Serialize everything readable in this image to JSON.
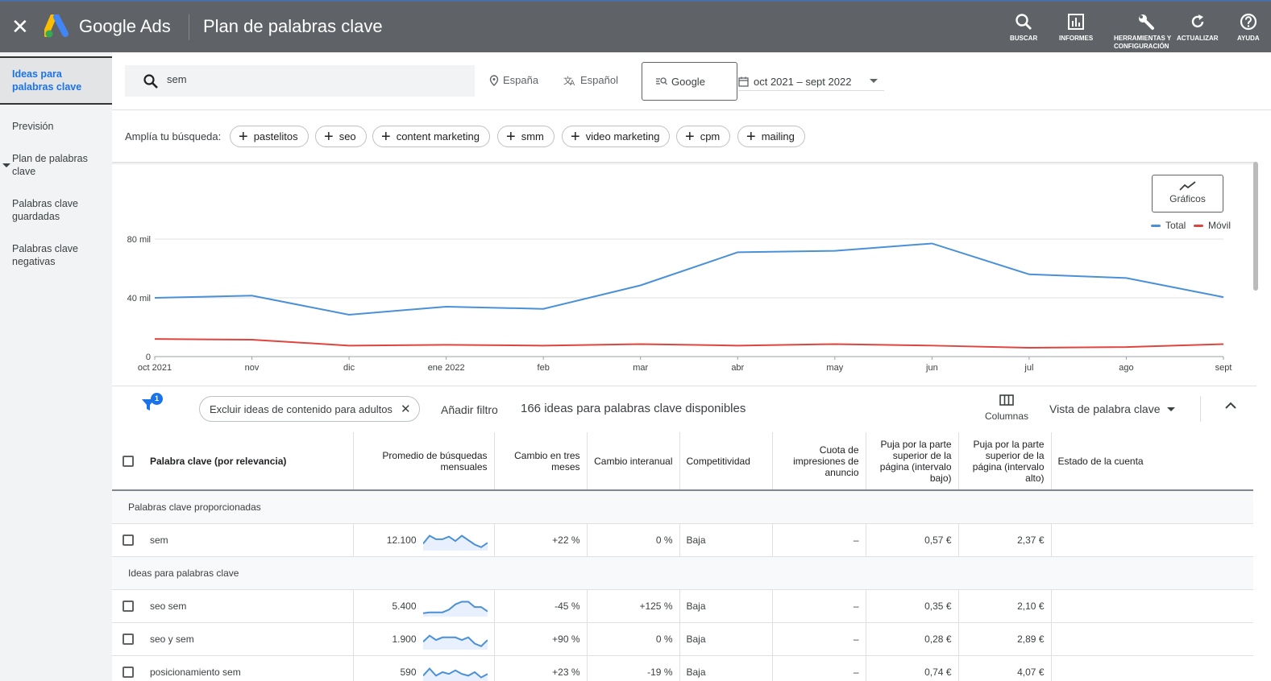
{
  "topbar": {
    "brand": "Google Ads",
    "page_title": "Plan de palabras clave",
    "tools": [
      {
        "label": "BUSCAR",
        "icon": "search-icon"
      },
      {
        "label": "INFORMES",
        "icon": "reports-icon"
      },
      {
        "label": "HERRAMIENTAS Y CONFIGURACIÓN",
        "icon": "wrench-icon"
      },
      {
        "label": "ACTUALIZAR",
        "icon": "refresh-icon"
      },
      {
        "label": "AYUDA",
        "icon": "help-icon"
      }
    ]
  },
  "sidebar": {
    "items": [
      {
        "label": "Ideas para palabras clave",
        "active": true
      },
      {
        "label": "Previsión"
      },
      {
        "label": "Plan de palabras clave"
      },
      {
        "label": "Palabras clave guardadas"
      },
      {
        "label": "Palabras clave negativas"
      }
    ]
  },
  "search": {
    "value": "sem",
    "location": "España",
    "language": "Español",
    "network": "Google",
    "date_range": "oct 2021 – sept 2022"
  },
  "broaden": {
    "label": "Amplía tu búsqueda:",
    "chips": [
      "pastelitos",
      "seo",
      "content marketing",
      "smm",
      "video marketing",
      "cpm",
      "mailing"
    ]
  },
  "chart_btn": "Gráficos",
  "chart_data": {
    "type": "line",
    "categories": [
      "oct 2021",
      "nov",
      "dic",
      "ene 2022",
      "feb",
      "mar",
      "abr",
      "may",
      "jun",
      "jul",
      "ago",
      "sept"
    ],
    "ylim": [
      0,
      80000
    ],
    "yticks": [
      {
        "v": 0,
        "label": "0"
      },
      {
        "v": 40000,
        "label": "40 mil"
      },
      {
        "v": 80000,
        "label": "80 mil"
      }
    ],
    "grid": true,
    "legend_position": "top-right",
    "series": [
      {
        "name": "Total",
        "color": "#4a90d9",
        "values": [
          40000,
          41500,
          28500,
          34000,
          32500,
          48500,
          71000,
          72000,
          77000,
          56000,
          53500,
          40500
        ]
      },
      {
        "name": "Móvil",
        "color": "#e0443e",
        "values": [
          12000,
          11500,
          7500,
          8000,
          7500,
          8500,
          7500,
          8500,
          7500,
          6000,
          6500,
          8500
        ]
      }
    ]
  },
  "filters": {
    "badge": "1",
    "chip": "Excluir ideas de contenido para adultos",
    "add_filter": "Añadir filtro",
    "count_text": "166 ideas para palabras clave disponibles",
    "columns_label": "Columnas",
    "view_label": "Vista de palabra clave"
  },
  "table": {
    "headers": [
      "Palabra clave (por relevancia)",
      "Promedio de búsquedas mensuales",
      "Cambio en tres meses",
      "Cambio interanual",
      "Competitividad",
      "Cuota de impresiones de anuncio",
      "Puja por la parte superior de la página (intervalo bajo)",
      "Puja por la parte superior de la página (intervalo alto)",
      "Estado de la cuenta"
    ],
    "group1": "Palabras clave proporcionadas",
    "group2": "Ideas para palabras clave",
    "rows": [
      {
        "keyword": "sem",
        "avg": "12.100",
        "trend": [
          0.3,
          0.75,
          0.55,
          0.55,
          0.7,
          0.45,
          0.75,
          0.5,
          0.25,
          0.1,
          0.35
        ],
        "three_month": "+22 %",
        "yoy": "0 %",
        "competition": "Baja",
        "share": "–",
        "low": "0,57 €",
        "high": "2,37 €"
      },
      {
        "keyword": "seo sem",
        "avg": "5.400",
        "trend": [
          0.1,
          0.15,
          0.15,
          0.15,
          0.3,
          0.6,
          0.75,
          0.75,
          0.45,
          0.45,
          0.2
        ],
        "three_month": "-45 %",
        "yoy": "+125 %",
        "competition": "Baja",
        "share": "–",
        "low": "0,35 €",
        "high": "2,10 €"
      },
      {
        "keyword": "seo y sem",
        "avg": "1.900",
        "trend": [
          0.35,
          0.7,
          0.45,
          0.6,
          0.6,
          0.6,
          0.45,
          0.6,
          0.25,
          0.1,
          0.45
        ],
        "three_month": "+90 %",
        "yoy": "0 %",
        "competition": "Baja",
        "share": "–",
        "low": "0,28 €",
        "high": "2,89 €"
      },
      {
        "keyword": "posicionamiento sem",
        "avg": "590",
        "trend": [
          0.3,
          0.7,
          0.3,
          0.5,
          0.4,
          0.6,
          0.4,
          0.3,
          0.5,
          0.2,
          0.4
        ],
        "three_month": "+23 %",
        "yoy": "-19 %",
        "competition": "Baja",
        "share": "–",
        "low": "0,74 €",
        "high": "4,07 €"
      }
    ]
  }
}
